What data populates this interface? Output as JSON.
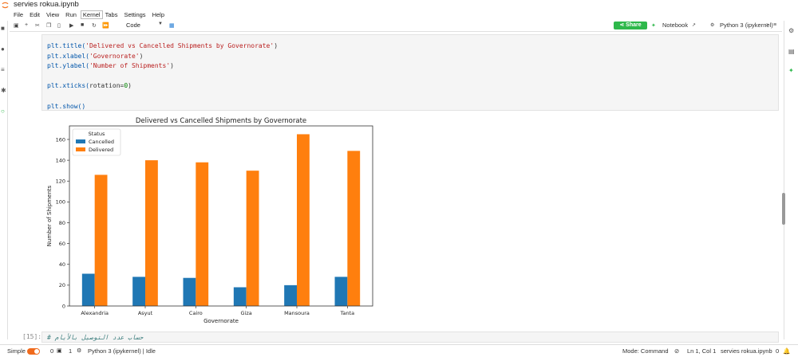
{
  "app": {
    "filename": "servies rokua.ipynb",
    "menu": [
      "File",
      "Edit",
      "View",
      "Run",
      "Kernel",
      "Tabs",
      "Settings",
      "Help"
    ]
  },
  "toolbar": {
    "cell_type": "Code",
    "share_label": "Share",
    "notebook_label": "Notebook",
    "kernel_label": "Python 3 (ipykernel)"
  },
  "cell": {
    "lines": [
      {
        "fn": "plt.title(",
        "str": "'Delivered vs Cancelled Shipments by Governorate'",
        "tail": ")"
      },
      {
        "fn": "plt.xlabel(",
        "str": "'Governorate'",
        "tail": ")"
      },
      {
        "fn": "plt.ylabel(",
        "str": "'Number of Shipments'",
        "tail": ")"
      },
      {
        "fn": "",
        "str": "",
        "tail": ""
      },
      {
        "fn": "plt.xticks(",
        "str": "rotation=",
        "num": "0",
        "tail": ")"
      },
      {
        "fn": "",
        "str": "",
        "tail": ""
      },
      {
        "fn": "plt.show()",
        "str": "",
        "tail": ""
      }
    ]
  },
  "next_cell": {
    "prompt": "[15]:",
    "comment": "# حساب عدد التوصيل بالأيام"
  },
  "statusbar": {
    "mode_label": "Simple",
    "count_a": "0",
    "count_b": "1",
    "kernel_status": "Python 3 (ipykernel) | Idle",
    "mode": "Mode: Command",
    "cursor": "Ln 1, Col 1",
    "file": "servies rokua.ipynb",
    "notifications": "0"
  },
  "chart_data": {
    "type": "bar",
    "title": "Delivered vs Cancelled Shipments by Governorate",
    "xlabel": "Governorate",
    "ylabel": "Number of Shipments",
    "categories": [
      "Alexandria",
      "Asyut",
      "Cairo",
      "Giza",
      "Mansoura",
      "Tanta"
    ],
    "series": [
      {
        "name": "Cancelled",
        "values": [
          31,
          28,
          27,
          18,
          20,
          28
        ],
        "color": "#1f77b4"
      },
      {
        "name": "Delivered",
        "values": [
          126,
          140,
          138,
          130,
          165,
          149
        ],
        "color": "#ff7f0e"
      }
    ],
    "ylim": [
      0,
      173
    ],
    "yticks": [
      0,
      20,
      40,
      60,
      80,
      100,
      120,
      140,
      160
    ],
    "legend_title": "Status",
    "legend_position": "top-left",
    "grid": false
  }
}
